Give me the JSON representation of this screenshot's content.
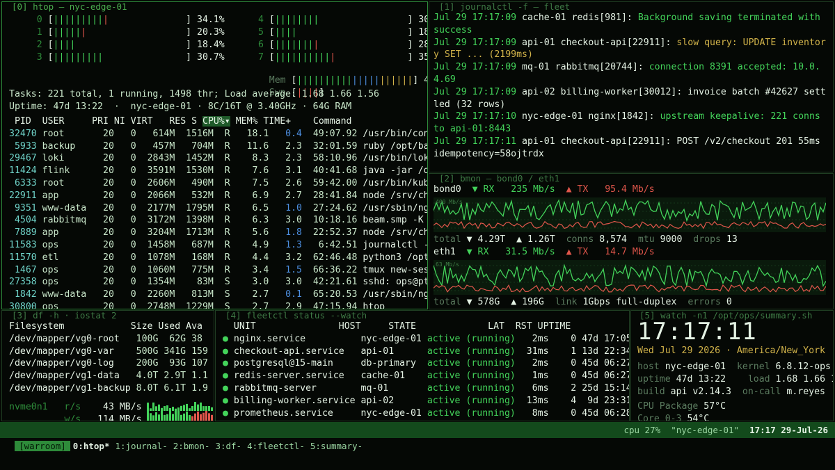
{
  "htop": {
    "title": "[0] htop — nyc-edge-01",
    "cpus": [
      {
        "id": "0",
        "bars": 10,
        "red": 1,
        "pct": "34.1%"
      },
      {
        "id": "1",
        "bars": 6,
        "red": 1,
        "pct": "20.3%"
      },
      {
        "id": "2",
        "bars": 4,
        "red": 0,
        "pct": "18.4%"
      },
      {
        "id": "3",
        "bars": 9,
        "red": 0,
        "pct": "30.7%"
      },
      {
        "id": "4",
        "bars": 8,
        "red": 0,
        "pct": "30"
      },
      {
        "id": "5",
        "bars": 4,
        "red": 0,
        "pct": "18"
      },
      {
        "id": "6",
        "bars": 8,
        "red": 1,
        "pct": "28"
      },
      {
        "id": "7",
        "bars": 11,
        "red": 1,
        "pct": "35"
      }
    ],
    "mem_label": "Mem",
    "mem_value": "40",
    "swp_label": "Swp",
    "swp_value": "1.",
    "tasks_line": "Tasks: 221 total, 1 running, 1498 thr; Load average: 1.68 1.66 1.56",
    "uptime_line": "Uptime: 47d 13:22  ·  nyc-edge-01 · 8C/16T @ 3.40GHz · 64G RAM",
    "columns": [
      "PID",
      "USER",
      "PRI",
      "NI",
      "VIRT",
      "RES",
      "S",
      "CPU%▾",
      "MEM%",
      "TIME+",
      "Command"
    ],
    "processes": [
      {
        "pid": "32470",
        "user": "root",
        "pri": "20",
        "ni": "0",
        "virt": "614M",
        "res": "1516M",
        "s": "R",
        "cpu": "18.1",
        "mem": "0.4",
        "time": "49:07.92",
        "cmd": "/usr/bin/conta"
      },
      {
        "pid": "5933",
        "user": "backup",
        "pri": "20",
        "ni": "0",
        "virt": "457M",
        "res": "704M",
        "s": "R",
        "cpu": "11.6",
        "mem": "2.3",
        "time": "32:01.59",
        "cmd": "ruby /opt/back"
      },
      {
        "pid": "29467",
        "user": "loki",
        "pri": "20",
        "ni": "0",
        "virt": "2843M",
        "res": "1452M",
        "s": "R",
        "cpu": "8.3",
        "mem": "2.3",
        "time": "58:10.96",
        "cmd": "/usr/bin/loki"
      },
      {
        "pid": "11424",
        "user": "flink",
        "pri": "20",
        "ni": "0",
        "virt": "3591M",
        "res": "1530M",
        "s": "R",
        "cpu": "7.6",
        "mem": "3.1",
        "time": "40:41.68",
        "cmd": "java -jar /opt"
      },
      {
        "pid": "6333",
        "user": "root",
        "pri": "20",
        "ni": "0",
        "virt": "2606M",
        "res": "490M",
        "s": "R",
        "cpu": "7.5",
        "mem": "2.6",
        "time": "59:42.00",
        "cmd": "/usr/bin/kubel"
      },
      {
        "pid": "22911",
        "user": "app",
        "pri": "20",
        "ni": "0",
        "virt": "2066M",
        "res": "532M",
        "s": "R",
        "cpu": "6.9",
        "mem": "2.7",
        "time": "28:41.84",
        "cmd": "node /srv/chec"
      },
      {
        "pid": "9351",
        "user": "www-data",
        "pri": "20",
        "ni": "0",
        "virt": "2177M",
        "res": "1795M",
        "s": "R",
        "cpu": "6.5",
        "mem": "1.0",
        "time": "27:24.62",
        "cmd": "/usr/sbin/ngin"
      },
      {
        "pid": "4504",
        "user": "rabbitmq",
        "pri": "20",
        "ni": "0",
        "virt": "3172M",
        "res": "1398M",
        "s": "R",
        "cpu": "6.3",
        "mem": "3.0",
        "time": "10:18.16",
        "cmd": "beam.smp -K tr"
      },
      {
        "pid": "7889",
        "user": "app",
        "pri": "20",
        "ni": "0",
        "virt": "3204M",
        "res": "1713M",
        "s": "R",
        "cpu": "5.6",
        "mem": "1.8",
        "time": "22:52.37",
        "cmd": "node /srv/chec"
      },
      {
        "pid": "11583",
        "user": "ops",
        "pri": "20",
        "ni": "0",
        "virt": "1458M",
        "res": "687M",
        "s": "R",
        "cpu": "4.9",
        "mem": "1.3",
        "time": "6:42.51",
        "cmd": "journalctl -f"
      },
      {
        "pid": "11570",
        "user": "etl",
        "pri": "20",
        "ni": "0",
        "virt": "1078M",
        "res": "168M",
        "s": "R",
        "cpu": "4.4",
        "mem": "3.2",
        "time": "62:46.48",
        "cmd": "python3 /opt/e"
      },
      {
        "pid": "1467",
        "user": "ops",
        "pri": "20",
        "ni": "0",
        "virt": "1060M",
        "res": "775M",
        "s": "R",
        "cpu": "3.4",
        "mem": "1.5",
        "time": "66:36.22",
        "cmd": "tmux new-sessi"
      },
      {
        "pid": "27358",
        "user": "ops",
        "pri": "20",
        "ni": "0",
        "virt": "1354M",
        "res": "83M",
        "s": "S",
        "cpu": "3.0",
        "mem": "3.0",
        "time": "42:21.61",
        "cmd": "sshd: ops@pts/"
      },
      {
        "pid": "1842",
        "user": "www-data",
        "pri": "20",
        "ni": "0",
        "virt": "2260M",
        "res": "813M",
        "s": "S",
        "cpu": "2.7",
        "mem": "0.1",
        "time": "65:20.53",
        "cmd": "/usr/sbin/ngin"
      },
      {
        "pid": "30800",
        "user": "ops",
        "pri": "20",
        "ni": "0",
        "virt": "2748M",
        "res": "1229M",
        "s": "S",
        "cpu": "2.7",
        "mem": "2.9",
        "time": "47:15.94",
        "cmd": "htop"
      }
    ]
  },
  "journal": {
    "title": "[1] journalctl -f — fleet",
    "lines": [
      {
        "ts": "Jul 29 17:17:09",
        "host": "cache-01",
        "unit": "redis[981]:",
        "msg": "Background saving terminated with success",
        "level": "info"
      },
      {
        "ts": "Jul 29 17:17:09",
        "host": "api-01",
        "unit": "checkout-api[22911]:",
        "msg": "slow query: UPDATE inventory SET ... (2199ms)",
        "level": "warn"
      },
      {
        "ts": "Jul 29 17:17:09",
        "host": "mq-01",
        "unit": "rabbitmq[20744]:",
        "msg": "connection 8391 accepted: 10.0.4.69",
        "level": "info"
      },
      {
        "ts": "Jul 29 17:17:09",
        "host": "api-02",
        "unit": "billing-worker[30012]:",
        "msg": "invoice batch #42627 settled (32 rows)",
        "level": "plain"
      },
      {
        "ts": "Jul 29 17:17:10",
        "host": "nyc-edge-01",
        "unit": "nginx[1842]:",
        "msg": "upstream keepalive: 221 conns to api-01:8443",
        "level": "info"
      },
      {
        "ts": "Jul 29 17:17:11",
        "host": "api-01",
        "unit": "checkout-api[22911]:",
        "msg": "POST /v2/checkout 201 55ms idempotency=58ojtrdx",
        "level": "plain"
      }
    ]
  },
  "bmon": {
    "title": "[2] bmon — bond0 / eth1",
    "ifaces": [
      {
        "name": "bond0",
        "rx_label": "▼ RX",
        "rx": "235 Mb/s",
        "tx_label": "▲ TX",
        "tx": "95.4 Mb/s",
        "scale": "400 Mb/s",
        "total_label": "total",
        "total_rx": "▼ 4.29T",
        "total_tx": "▲ 1.26T",
        "k1": "conns",
        "v1": "8,574",
        "k2": "mtu",
        "v2": "9000",
        "k3": "drops",
        "v3": "13"
      },
      {
        "name": "eth1",
        "rx_label": "▼ RX",
        "rx": "31.5 Mb/s",
        "tx_label": "▲ TX",
        "tx": "14.7 Mb/s",
        "scale": "63 Mb/s",
        "total_label": "total",
        "total_rx": "▼ 578G",
        "total_tx": "▲ 196G",
        "k1": "link",
        "v1": "1Gbps full-duplex",
        "k2": "errors",
        "v2": "0",
        "k3": "",
        "v3": ""
      }
    ]
  },
  "df": {
    "title": "[3] df -h · iostat 2",
    "columns": [
      "Filesystem",
      "Size",
      "Used",
      "Ava"
    ],
    "rows": [
      {
        "fs": "/dev/mapper/vg0-root",
        "size": "100G",
        "used": "62G",
        "avail": "38"
      },
      {
        "fs": "/dev/mapper/vg0-var",
        "size": "500G",
        "used": "341G",
        "avail": "159"
      },
      {
        "fs": "/dev/mapper/vg0-log",
        "size": "200G",
        "used": "93G",
        "avail": "107"
      },
      {
        "fs": "/dev/mapper/vg1-data",
        "size": "4.0T",
        "used": "2.9T",
        "avail": "1.1"
      },
      {
        "fs": "/dev/mapper/vg1-backup",
        "size": "8.0T",
        "used": "6.1T",
        "avail": "1.9"
      }
    ],
    "io": {
      "dev": "nvme0n1",
      "r_label": "r/s",
      "r_val": "43 MB/s",
      "w_label": "w/s",
      "w_val": "114 MB/s"
    }
  },
  "fleet": {
    "title": "[4] fleetctl status --watch",
    "columns": [
      "UNIT",
      "HOST",
      "STATE",
      "LAT",
      "RST",
      "UPTIME"
    ],
    "rows": [
      {
        "unit": "nginx.service",
        "host": "nyc-edge-01",
        "state": "active (running)",
        "lat": "2ms",
        "rst": "0",
        "uptime": "47d 17:05"
      },
      {
        "unit": "checkout-api.service",
        "host": "api-01",
        "state": "active (running)",
        "lat": "31ms",
        "rst": "1",
        "uptime": "13d 22:34"
      },
      {
        "unit": "postgresql@15-main",
        "host": "db-primary",
        "state": "active (running)",
        "lat": "2ms",
        "rst": "0",
        "uptime": "45d 06:27"
      },
      {
        "unit": "redis-server.service",
        "host": "cache-01",
        "state": "active (running)",
        "lat": "1ms",
        "rst": "0",
        "uptime": "45d 06:27"
      },
      {
        "unit": "rabbitmq-server",
        "host": "mq-01",
        "state": "active (running)",
        "lat": "6ms",
        "rst": "2",
        "uptime": "25d 15:14"
      },
      {
        "unit": "billing-worker.service",
        "host": "api-02",
        "state": "active (running)",
        "lat": "13ms",
        "rst": "4",
        "uptime": "9d 23:31"
      },
      {
        "unit": "prometheus.service",
        "host": "nyc-edge-01",
        "state": "active (running)",
        "lat": "8ms",
        "rst": "0",
        "uptime": "45d 06:28"
      }
    ]
  },
  "summary": {
    "title": "[5] watch -n1 /opt/ops/summary.sh",
    "clock": "17:17:11",
    "date": "Wed Jul 29 2026 · America/New_York",
    "host_k": "host",
    "host_v": "nyc-edge-01",
    "kernel_k": "kernel",
    "kernel_v": "6.8.12-ops",
    "uptime_k": "uptime",
    "uptime_v": "47d 13:22",
    "load_k": "load",
    "load_v": "1.68 1.66 1.",
    "build_k": "build",
    "build_v": "api v2.14.3",
    "oncall_k": "on-call",
    "oncall_v": "m.reyes",
    "temp1_k": "CPU Package",
    "temp1_v": "57°C",
    "temp2_k": "Core 0-3",
    "temp2_v": "54°C"
  },
  "statusbar": {
    "session": "[warroom]",
    "windows": [
      "0:htop*",
      "1:journal-",
      "2:bmon-",
      "3:df-",
      "4:fleetctl-",
      "5:summary-"
    ],
    "cpu": "cpu 27%",
    "host": "\"nyc-edge-01\"",
    "time": "17:17 29-Jul-26"
  }
}
